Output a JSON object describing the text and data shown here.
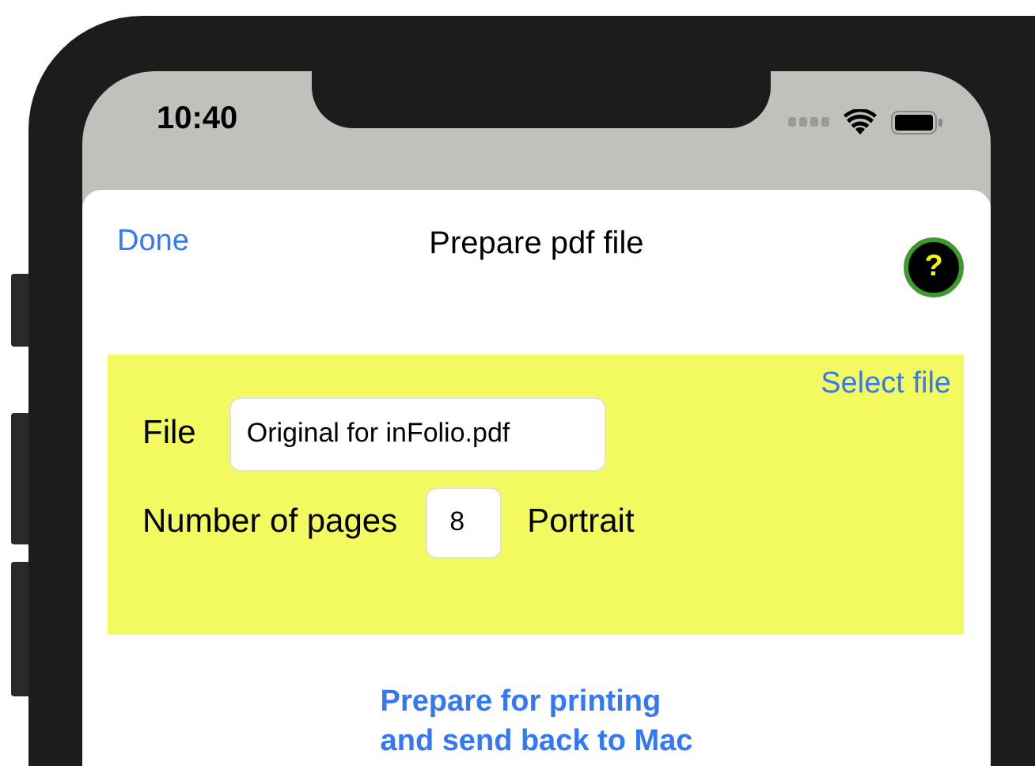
{
  "status_bar": {
    "time": "10:40"
  },
  "sheet": {
    "done": "Done",
    "title": "Prepare pdf file",
    "help": "?"
  },
  "panel": {
    "select_file": "Select file",
    "file_label": "File",
    "file_value": "Original for inFolio.pdf",
    "pages_label": "Number of pages",
    "pages_value": "8",
    "orientation": "Portrait"
  },
  "action": "Prepare for printing\nand send back to Mac"
}
